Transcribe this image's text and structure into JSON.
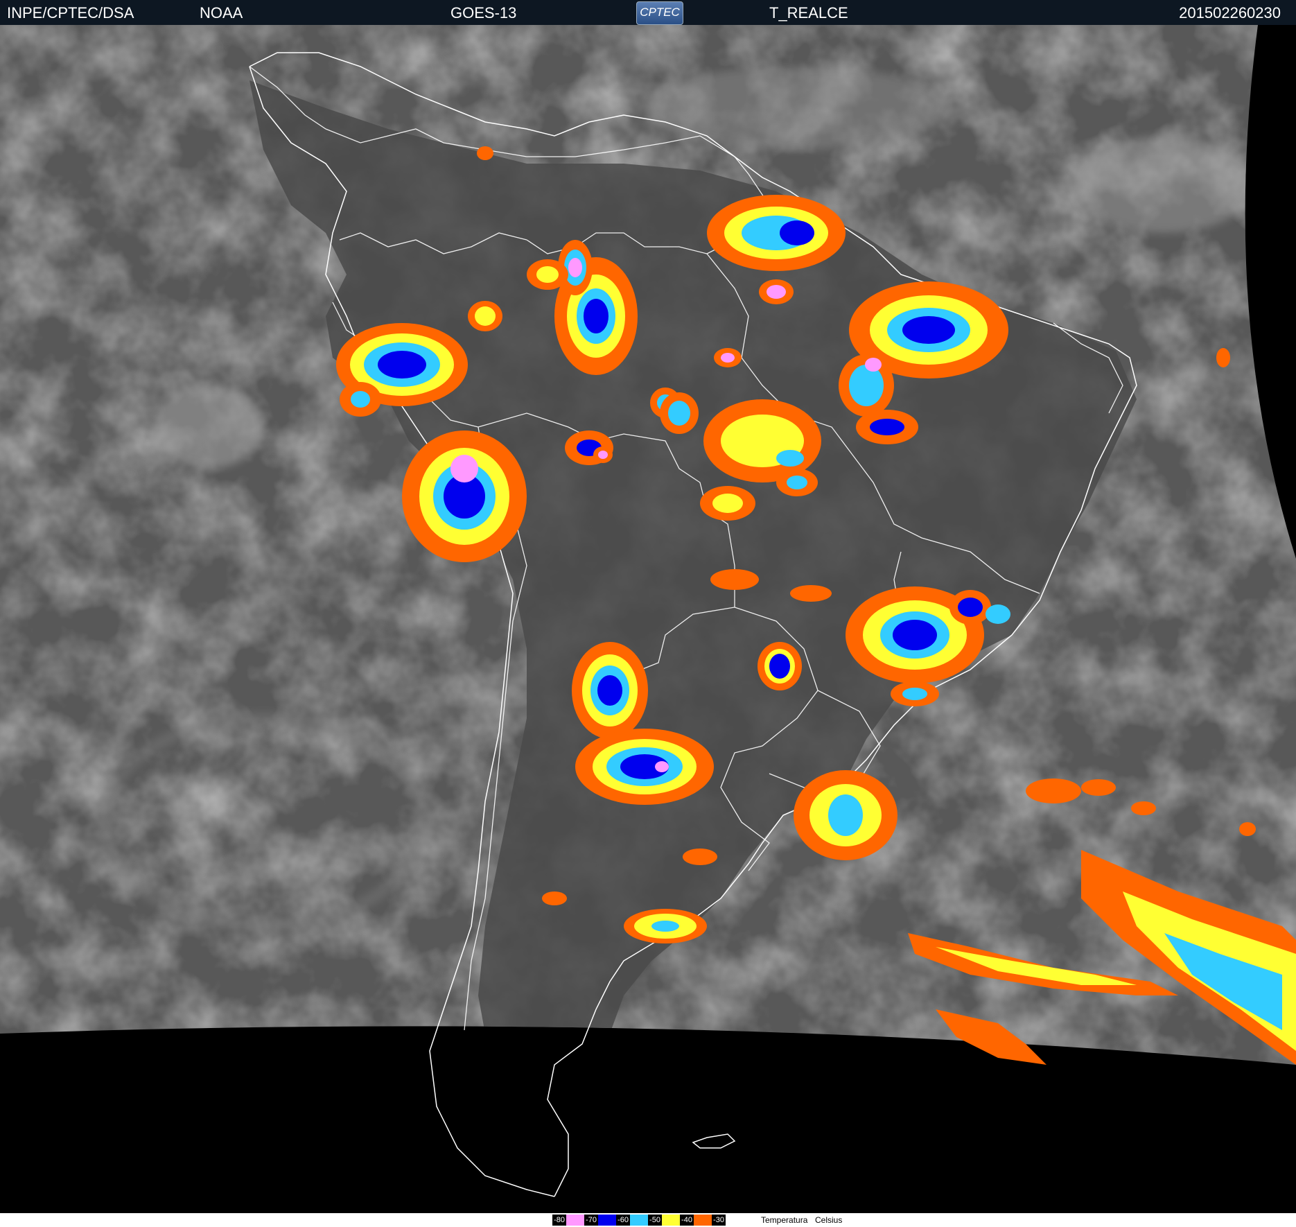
{
  "header": {
    "organization": "INPE/CPTEC/DSA",
    "agency": "NOAA",
    "satellite": "GOES-13",
    "logo_text": "CPTEC",
    "product": "T_REALCE",
    "timestamp": "201502260230"
  },
  "legend": {
    "title": "Temperatura",
    "unit": "Celsius",
    "scale": [
      {
        "label": "-80",
        "color": "#ff99ff"
      },
      {
        "label": "-70",
        "color": "#0000ee"
      },
      {
        "label": "-60",
        "color": "#33ccff"
      },
      {
        "label": "-50",
        "color": "#ffff33"
      },
      {
        "label": "-40",
        "color": "#ff6600"
      },
      {
        "label": "-30",
        "color": "#ffffff"
      }
    ]
  },
  "colors": {
    "space": "#000000",
    "header_bg": "#0d1722",
    "ocean_gray": "#585858",
    "borders": "#ffffff"
  }
}
